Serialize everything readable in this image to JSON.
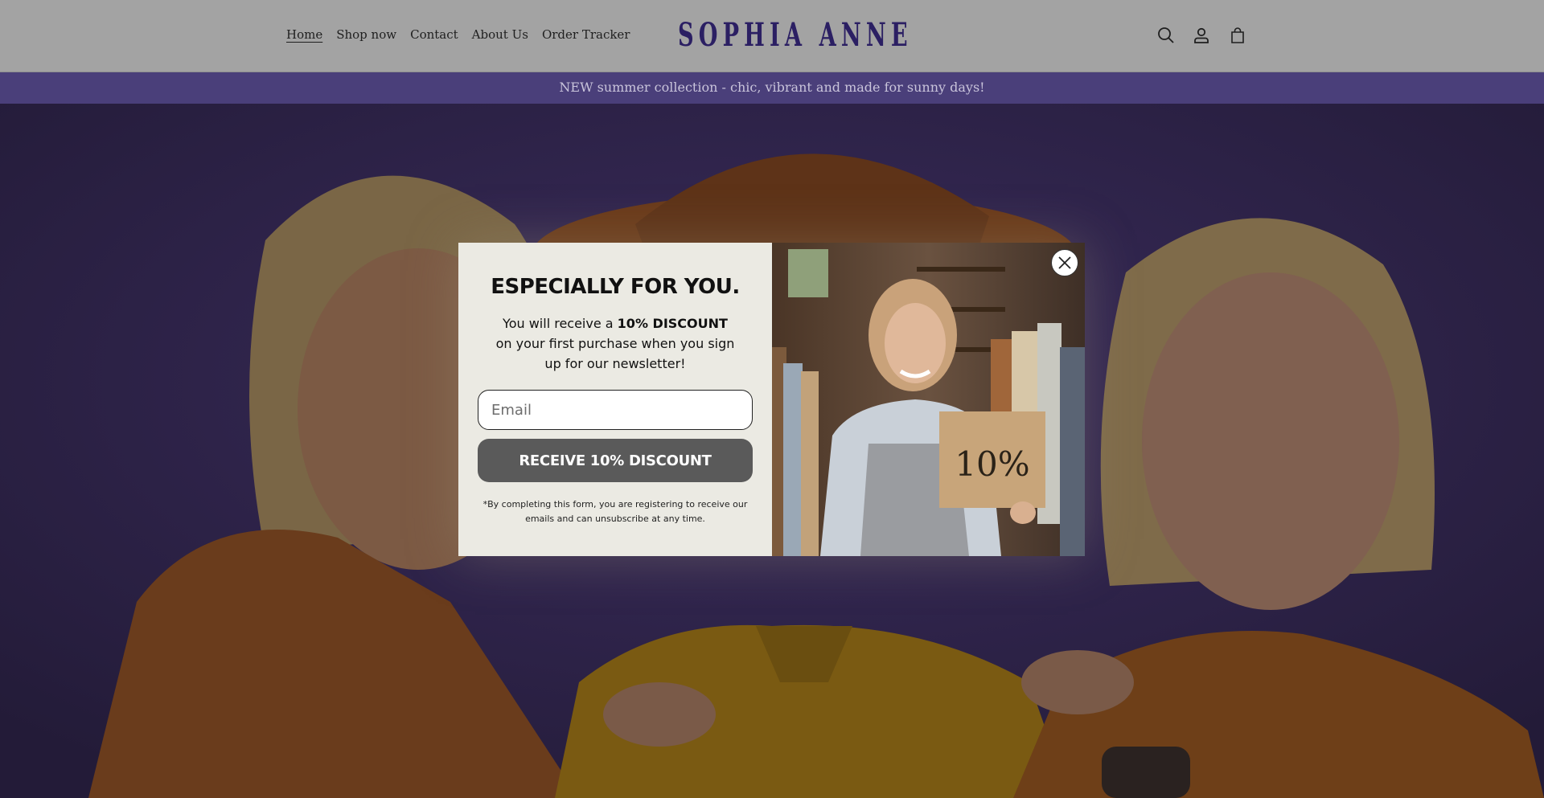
{
  "header": {
    "nav": [
      "Home",
      "Shop now",
      "Contact",
      "About Us",
      "Order Tracker"
    ],
    "logo": "SOPHIA ANNE",
    "icons": [
      "search-icon",
      "account-icon",
      "cart-icon"
    ]
  },
  "announcement": {
    "text": "NEW summer collection - chic, vibrant and made for sunny days!"
  },
  "popup": {
    "title": "ESPECIALLY FOR YOU.",
    "body_prefix": "You will receive a ",
    "body_bold": "10% DISCOUNT",
    "body_suffix": "on your first purchase when you sign up for our newsletter!",
    "email_placeholder": "Email",
    "cta_label": "RECEIVE 10% DISCOUNT",
    "disclaimer": "*By completing this form, you are registering to receive our emails and can unsubscribe at any time.",
    "sign_text": "10%"
  },
  "colors": {
    "header_bg": "#a3a3a3",
    "logo": "#2b1f63",
    "announcement_bg": "#4a3f7a",
    "popup_bg": "#ebeae3",
    "cta_bg": "#5a5a5a"
  }
}
